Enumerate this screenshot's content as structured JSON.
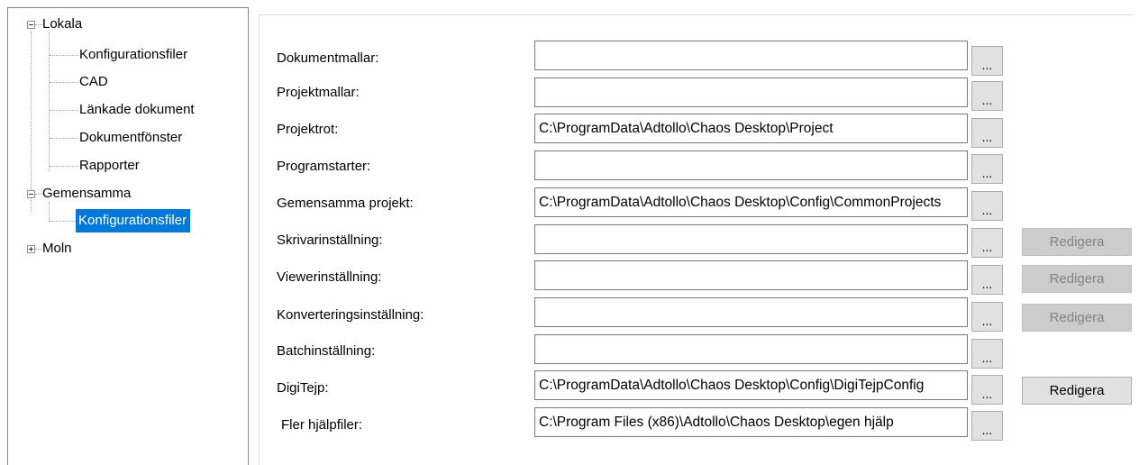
{
  "tree": {
    "lokala": {
      "label": "Lokala",
      "children": [
        "Konfigurationsfiler",
        "CAD",
        "Länkade dokument",
        "Dokumentfönster",
        "Rapporter"
      ]
    },
    "gemensamma": {
      "label": "Gemensamma",
      "children": [
        "Konfigurationsfiler"
      ]
    },
    "moln": {
      "label": "Moln"
    },
    "selected": "Gemensamma / Konfigurationsfiler"
  },
  "settings": [
    {
      "label": "Dokumentmallar:",
      "value": "",
      "browse": "...",
      "edit": null
    },
    {
      "label": "Projektmallar:",
      "value": "",
      "browse": "...",
      "edit": null
    },
    {
      "label": "Projektrot:",
      "value": "C:\\ProgramData\\Adtollo\\Chaos Desktop\\Project",
      "browse": "...",
      "edit": null
    },
    {
      "label": "Programstarter:",
      "value": "",
      "browse": "...",
      "edit": null
    },
    {
      "label": "Gemensamma projekt:",
      "value": "C:\\ProgramData\\Adtollo\\Chaos Desktop\\Config\\CommonProjects",
      "browse": "...",
      "edit": null
    },
    {
      "label": "Skrivarinställning:",
      "value": "",
      "browse": "...",
      "edit": {
        "label": "Redigera",
        "enabled": false
      }
    },
    {
      "label": "Viewerinställning:",
      "value": "",
      "browse": "...",
      "edit": {
        "label": "Redigera",
        "enabled": false
      }
    },
    {
      "label": "Konverteringsinställning:",
      "value": "",
      "browse": "...",
      "edit": {
        "label": "Redigera",
        "enabled": false
      }
    },
    {
      "label": "Batchinställning:",
      "value": "",
      "browse": "...",
      "edit": null
    },
    {
      "label": "DigiTejp:",
      "value": "C:\\ProgramData\\Adtollo\\Chaos Desktop\\Config\\DigiTejpConfig",
      "browse": "...",
      "edit": {
        "label": "Redigera",
        "enabled": true
      }
    },
    {
      "label": "Fler hjälpfiler:",
      "value": "C:\\Program Files (x86)\\Adtollo\\Chaos Desktop\\egen hjälp",
      "browse": "...",
      "edit": null
    }
  ],
  "colors": {
    "selection": "#0078d7",
    "button_face": "#e1e1e1",
    "button_disabled": "#cccccc",
    "disabled_text": "#838383"
  }
}
